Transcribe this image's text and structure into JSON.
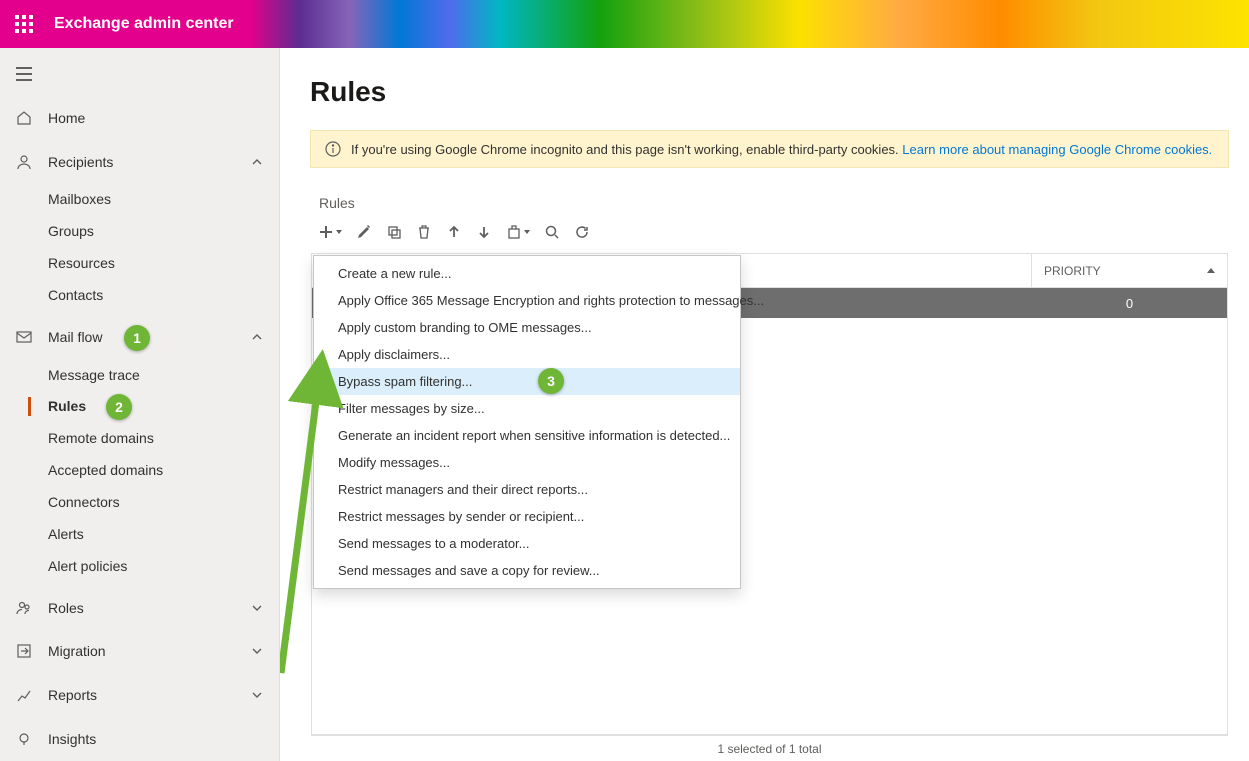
{
  "header": {
    "app_title": "Exchange admin center"
  },
  "sidebar": {
    "home": "Home",
    "recipients": {
      "label": "Recipients",
      "items": [
        "Mailboxes",
        "Groups",
        "Resources",
        "Contacts"
      ]
    },
    "mailflow": {
      "label": "Mail flow",
      "items": [
        "Message trace",
        "Rules",
        "Remote domains",
        "Accepted domains",
        "Connectors",
        "Alerts",
        "Alert policies"
      ]
    },
    "roles": "Roles",
    "migration": "Migration",
    "reports": "Reports",
    "insights": "Insights"
  },
  "page": {
    "title": "Rules",
    "banner_text": "If you're using Google Chrome incognito and this page isn't working, enable third-party cookies. ",
    "banner_link": "Learn more about managing Google Chrome cookies.",
    "section_label": "Rules",
    "columns": {
      "priority": "PRIORITY"
    },
    "row0_priority": "0",
    "status": "1 selected of 1 total"
  },
  "dropdown": {
    "items": [
      "Create a new rule...",
      "Apply Office 365 Message Encryption and rights protection to messages...",
      "Apply custom branding to OME messages...",
      "Apply disclaimers...",
      "Bypass spam filtering...",
      "Filter messages by size...",
      "Generate an incident report when sensitive information is detected...",
      "Modify messages...",
      "Restrict managers and their direct reports...",
      "Restrict messages by sender or recipient...",
      "Send messages to a moderator...",
      "Send messages and save a copy for review..."
    ]
  },
  "badges": {
    "b1": "1",
    "b2": "2",
    "b3": "3"
  }
}
